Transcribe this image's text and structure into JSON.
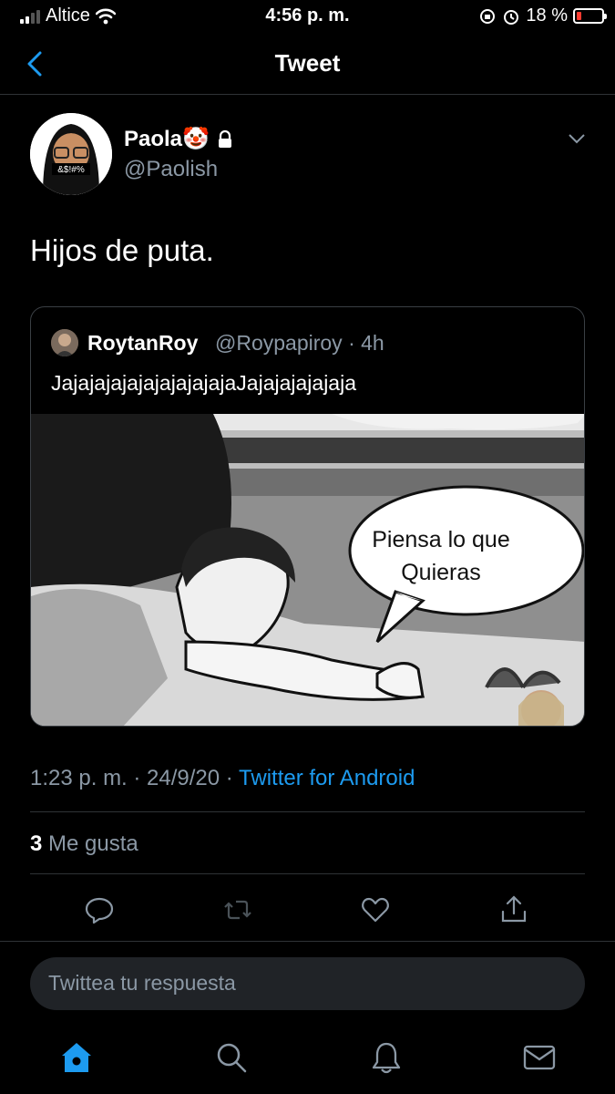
{
  "status_bar": {
    "carrier": "Altice",
    "time": "4:56 p. m.",
    "battery": "18 %",
    "battery_level": 0.18
  },
  "nav": {
    "title": "Tweet",
    "back_icon": "chevron-left-icon"
  },
  "tweet": {
    "author_name": "Paola🤡",
    "author_handle": "@Paolish",
    "text": "Hijos de puta.",
    "avatar_text": "&$!#%",
    "quoted": {
      "author_name": "RoytanRoy",
      "author_handle": "@Roypapiroy",
      "time": "· 4h",
      "text": "JajajajajajajajajajajaJajajajajajaja",
      "image_caption": "Piensa lo que Quieras"
    },
    "timestamp": "1:23 p. m. · 24/9/20 ·",
    "source": "Twitter for Android",
    "likes_count": "3",
    "likes_label": "Me gusta"
  },
  "reply": {
    "placeholder": "Twittea tu respuesta"
  },
  "colors": {
    "accent": "#1d9bf0",
    "secondary_text": "#8b98a5",
    "divider": "#2f3336"
  }
}
